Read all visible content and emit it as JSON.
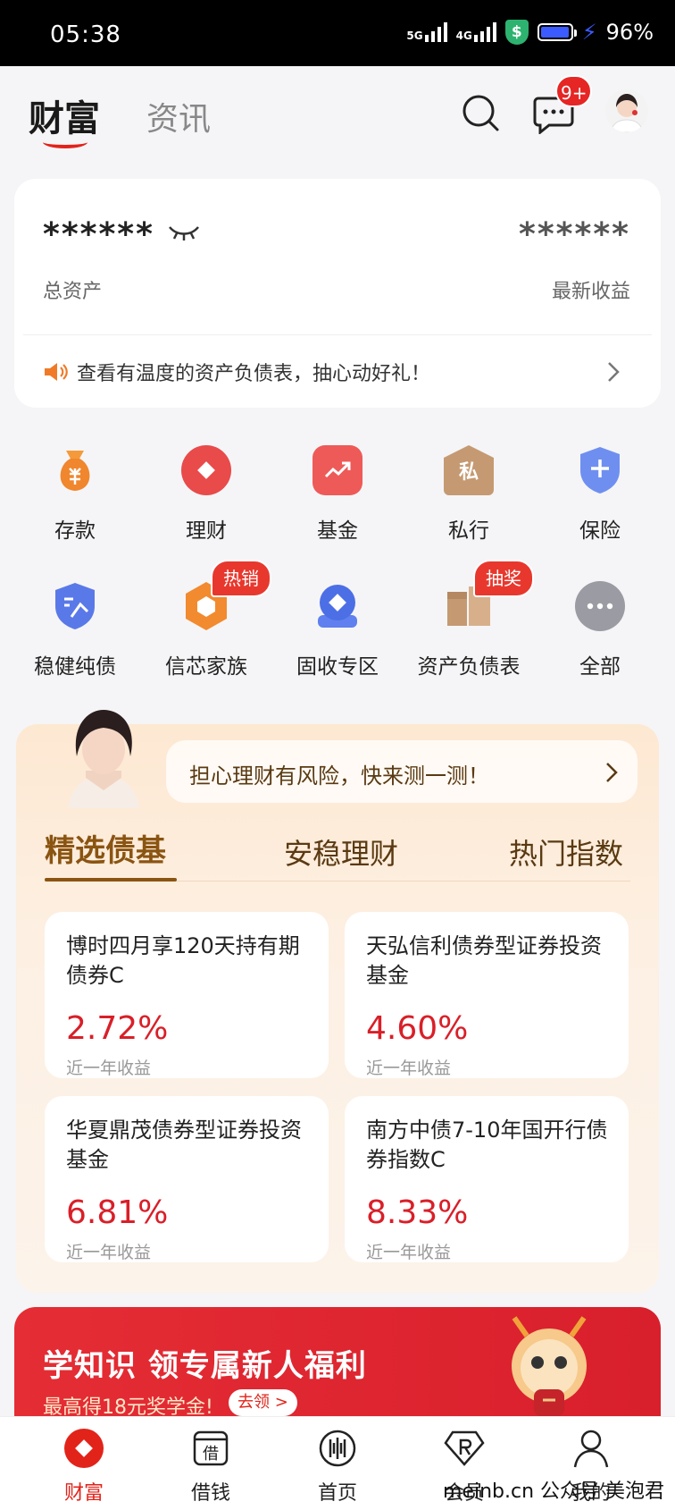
{
  "status_bar": {
    "time": "05:38",
    "net1": "5G",
    "net2": "4G",
    "shield": "$",
    "battery": "96%"
  },
  "header": {
    "tab_active": "财富",
    "tab_other": "资讯",
    "msg_badge": "9+"
  },
  "asset": {
    "masked_total": "******",
    "masked_income": "******",
    "total_label": "总资产",
    "income_label": "最新收益",
    "notice": "查看有温度的资产负债表，抽心动好礼！"
  },
  "grid": {
    "row1": [
      "存款",
      "理财",
      "基金",
      "私行",
      "保险"
    ],
    "row2": [
      "稳健纯债",
      "信芯家族",
      "固收专区",
      "资产负债表",
      "全部"
    ],
    "private_char": "私",
    "badge_hot": "热销",
    "badge_lottery": "抽奖"
  },
  "fund_section": {
    "ask": "担心理财有风险，快来测一测！",
    "tabs": [
      "精选债基",
      "安稳理财",
      "热门指数"
    ],
    "cards": [
      {
        "name": "博时四月享120天持有期债券C",
        "rate": "2.72%",
        "sub": "近一年收益"
      },
      {
        "name": "天弘信利债券型证券投资基金",
        "rate": "4.60%",
        "sub": "近一年收益"
      },
      {
        "name": "华夏鼎茂债券型证券投资基金",
        "rate": "6.81%",
        "sub": "近一年收益"
      },
      {
        "name": "南方中债7-10年国开行债券指数C",
        "rate": "8.33%",
        "sub": "近一年收益"
      }
    ]
  },
  "banner": {
    "title": "学知识 领专属新人福利",
    "sub": "最高得18元奖学金!",
    "btn": "去领 >"
  },
  "nav": {
    "items": [
      "财富",
      "借钱",
      "首页",
      "会员",
      "我的"
    ],
    "jie": "借"
  },
  "watermark": "meinb.cn 公众号 美泡君",
  "colors": {
    "brand_red": "#e2231a",
    "gold": "#8a5411"
  }
}
